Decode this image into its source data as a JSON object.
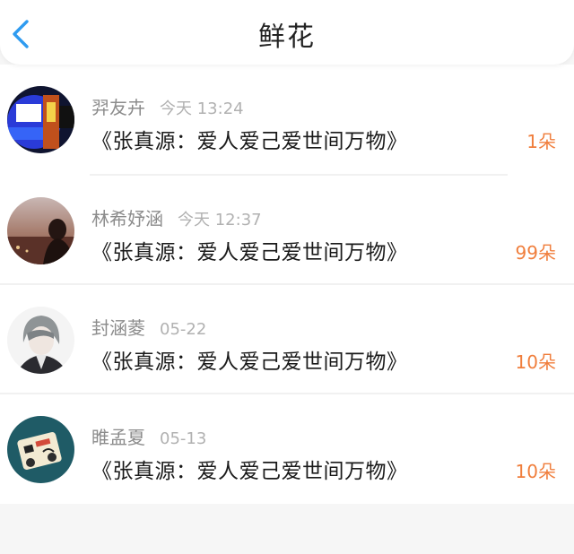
{
  "header": {
    "title": "鲜花",
    "back_icon": "chevron-left-icon",
    "accent_color": "#2e9bf0"
  },
  "list": {
    "items": [
      {
        "name": "羿友卉",
        "time": "今天 13:24",
        "title": "《张真源：爱人爱己爱世间万物》",
        "count": "1朵"
      },
      {
        "name": "林希妤涵",
        "time": "今天 12:37",
        "title": "《张真源：爱人爱己爱世间万物》",
        "count": "99朵"
      },
      {
        "name": "封涵菱",
        "time": "05-22",
        "title": "《张真源：爱人爱己爱世间万物》",
        "count": "10朵"
      },
      {
        "name": "睢孟夏",
        "time": "05-13",
        "title": "《张真源：爱人爱己爱世间万物》",
        "count": "10朵"
      }
    ],
    "count_color": "#f07e3c"
  }
}
